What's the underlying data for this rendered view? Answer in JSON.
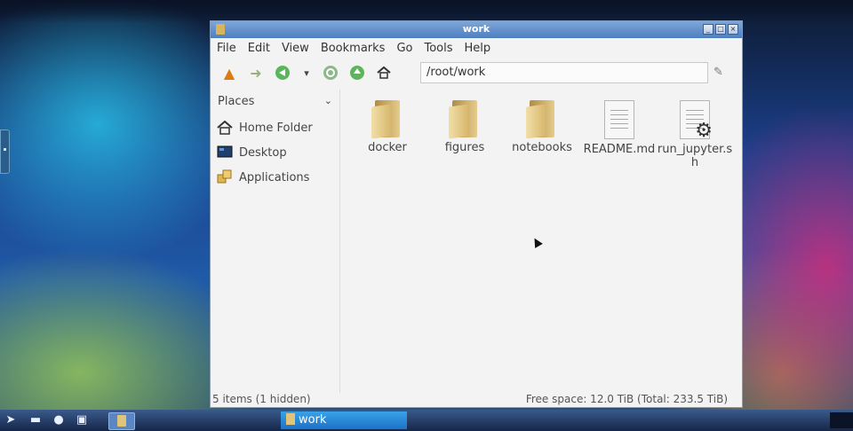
{
  "window": {
    "title": "work",
    "controls": [
      "minimize",
      "maximize",
      "close"
    ]
  },
  "menubar": [
    "File",
    "Edit",
    "View",
    "Bookmarks",
    "Go",
    "Tools",
    "Help"
  ],
  "toolbar": {
    "path": "/root/work",
    "icons": [
      "warning-icon",
      "forward-icon",
      "back-icon",
      "history-dropdown-icon",
      "reload-icon",
      "up-icon",
      "home-icon"
    ]
  },
  "sidebar": {
    "header": "Places",
    "items": [
      {
        "label": "Home Folder",
        "icon": "home-icon"
      },
      {
        "label": "Desktop",
        "icon": "desktop-icon"
      },
      {
        "label": "Applications",
        "icon": "applications-icon"
      }
    ]
  },
  "files": [
    {
      "name": "docker",
      "type": "folder"
    },
    {
      "name": "figures",
      "type": "folder"
    },
    {
      "name": "notebooks",
      "type": "folder"
    },
    {
      "name": "README.md",
      "type": "text"
    },
    {
      "name": "run_jupyter.sh",
      "type": "script"
    }
  ],
  "status": {
    "items": "5 items (1 hidden)",
    "free_space": "Free space: 12.0 TiB (Total: 233.5 TiB)"
  },
  "taskbar": {
    "active_task": "work"
  },
  "colors": {
    "titlebar": "#5a88c6",
    "task_active": "#2a8ad8",
    "taskbar": "#1e3358"
  }
}
